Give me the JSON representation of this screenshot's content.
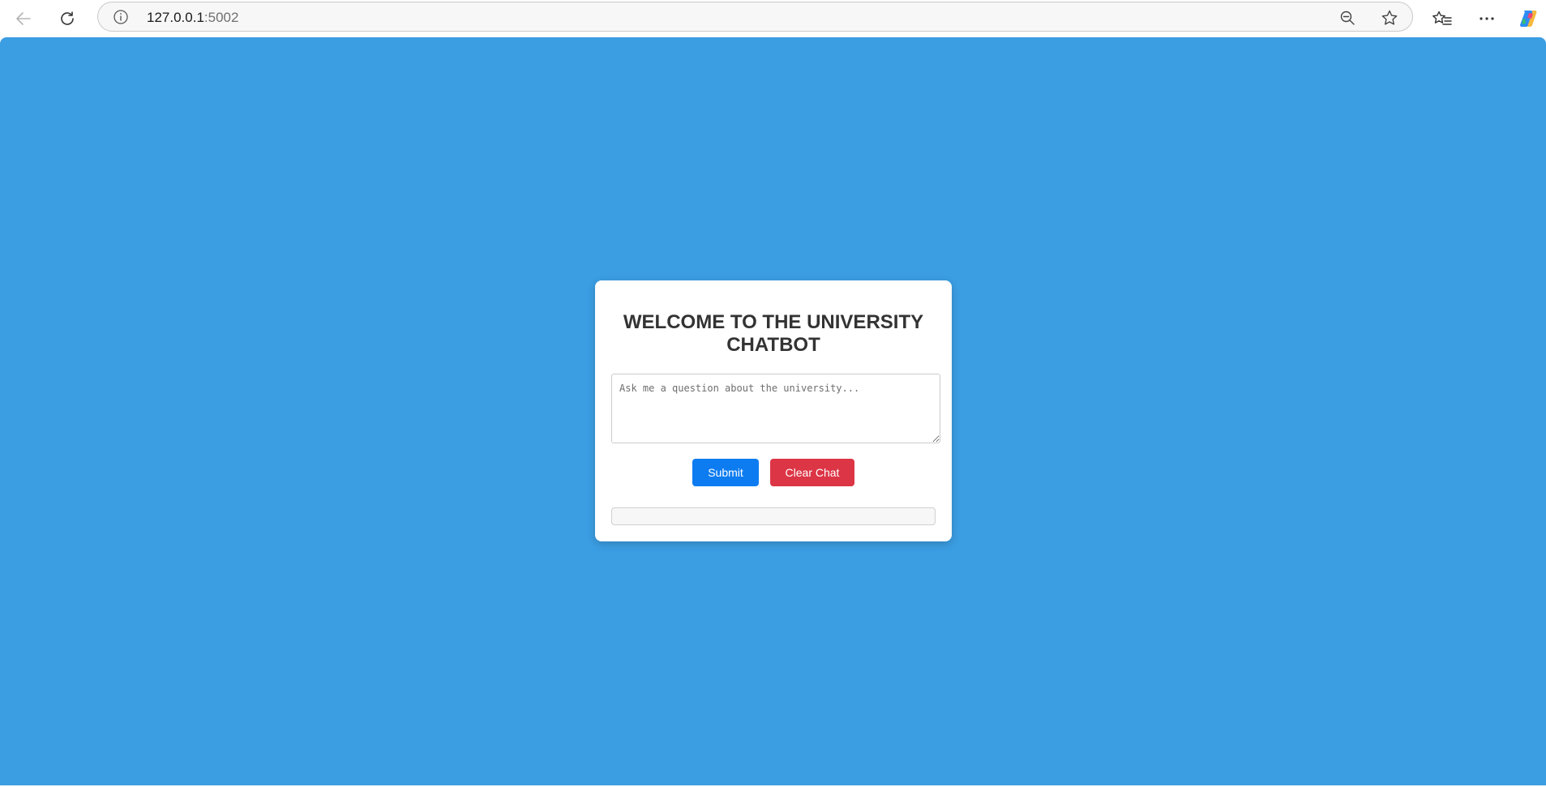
{
  "browser": {
    "url_host": "127.0.0.1",
    "url_port": ":5002",
    "icons": {
      "back": "back-arrow-icon",
      "reload": "reload-icon",
      "site_info": "info-icon",
      "zoom": "zoom-out-icon",
      "favorite": "star-icon",
      "favorites_list": "favorites-icon",
      "more": "more-icon",
      "copilot": "copilot-icon"
    }
  },
  "page": {
    "background_color": "#3b9de2",
    "title": "WELCOME TO THE UNIVERSITY CHATBOT",
    "question_placeholder": "Ask me a question about the university...",
    "question_value": "",
    "submit_label": "Submit",
    "clear_label": "Clear Chat",
    "submit_color": "#0d7cf0",
    "clear_color": "#dc3545",
    "chat_log_text": ""
  }
}
